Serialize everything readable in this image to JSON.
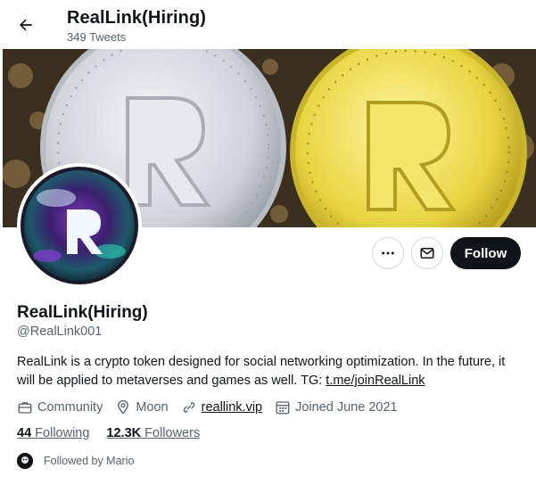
{
  "header": {
    "title": "RealLink(Hiring)",
    "tweets_count": "349 Tweets"
  },
  "profile": {
    "name": "RealLink(Hiring)",
    "handle": "@RealLink001",
    "bio_text": "RealLink is a crypto token designed for social networking optimization. In the future, it will be applied to metaverses and games as well. TG: ",
    "bio_link": "t.me/joinRealLink",
    "category": "Community",
    "location": "Moon",
    "website": "reallink.vip",
    "joined": "Joined June 2021"
  },
  "actions": {
    "more_icon": "more-horizontal-icon",
    "message_icon": "envelope-icon",
    "follow_label": "Follow"
  },
  "stats": {
    "following_count": "44",
    "following_label": "Following",
    "followers_count": "12.3K",
    "followers_label": "Followers"
  },
  "followed_by": "Followed by Mario",
  "colors": {
    "text_primary": "#0f1419",
    "text_secondary": "#536471",
    "follow_button": "#0f1419",
    "border": "#cfd9de"
  }
}
